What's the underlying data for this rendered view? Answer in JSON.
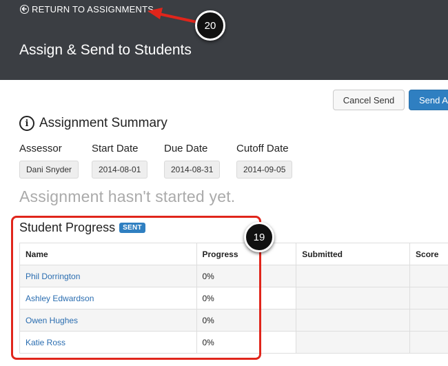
{
  "header": {
    "return_label": "RETURN TO ASSIGNMENTS",
    "title": "Assign & Send to Students",
    "background": "#3b3e43"
  },
  "callouts": {
    "return": "20",
    "progress": "19"
  },
  "actions": {
    "cancel_label": "Cancel Send",
    "send_label": "Send As",
    "accent": "#2f7fc1"
  },
  "summary": {
    "title": "Assignment Summary",
    "fields": [
      {
        "label": "Assessor",
        "value": "Dani Snyder"
      },
      {
        "label": "Start Date",
        "value": "2014-08-01"
      },
      {
        "label": "Due Date",
        "value": "2014-08-31"
      },
      {
        "label": "Cutoff Date",
        "value": "2014-09-05"
      }
    ],
    "status_text": "Assignment hasn't started yet."
  },
  "progress": {
    "title": "Student Progress",
    "badge": "SENT",
    "columns": [
      "Name",
      "Progress",
      "",
      "Submitted",
      "Score"
    ],
    "rows": [
      {
        "name": "Phil Dorrington",
        "progress": "0%"
      },
      {
        "name": "Ashley Edwardson",
        "progress": "0%"
      },
      {
        "name": "Owen Hughes",
        "progress": "0%"
      },
      {
        "name": "Katie Ross",
        "progress": "0%"
      }
    ]
  },
  "annotation_color": "#e0251b"
}
